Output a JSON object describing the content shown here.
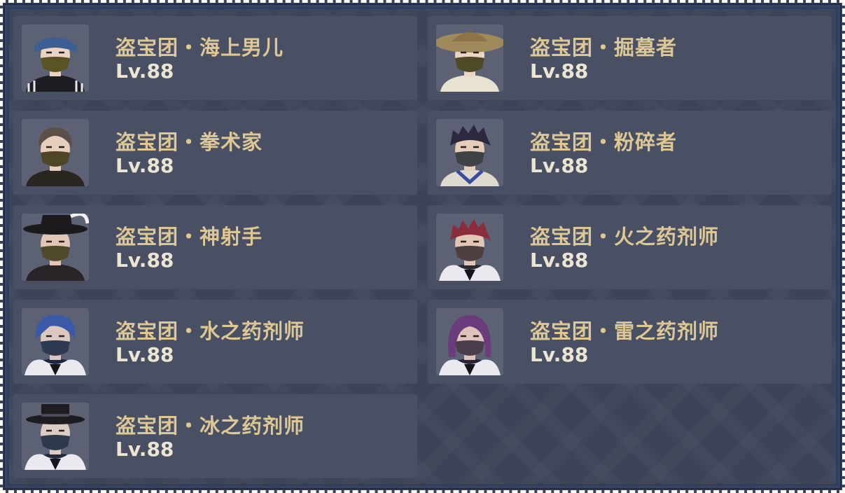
{
  "colors": {
    "name_text": "#dcc795",
    "level_text": "#ece5d3",
    "card_bg": "#4a5063",
    "panel_bg": "#3e4457",
    "border_dash": "#ffffff",
    "border_inner": "#2b3f63"
  },
  "enemies": [
    {
      "name": "盗宝团・海上男儿",
      "level": "Lv.88",
      "avatar_icon": "sailor-hooligan-portrait-icon",
      "hair": "#3a5a8c",
      "hat": "headband",
      "hat_color": "#3b5f92",
      "mask": "#5a5326",
      "skin": "#e9d3c2",
      "clothes": "#1d1d24",
      "collar": "stripe"
    },
    {
      "name": "盗宝团・掘墓者",
      "level": "Lv.88",
      "avatar_icon": "grave-robber-portrait-icon",
      "hair": "#4a3b2e",
      "hat": "straw",
      "hat_color": "#a08a5c",
      "mask": "#4d4a28",
      "skin": "#ead6c4",
      "clothes": "#e8e2d2",
      "collar": "plain"
    },
    {
      "name": "盗宝团・拳术家",
      "level": "Lv.88",
      "avatar_icon": "handyman-portrait-icon",
      "hair": "#5a5048",
      "hat": "none",
      "hat_color": "#000000",
      "mask": "#4f4628",
      "skin": "#e6cfbd",
      "clothes": "#2b2520",
      "collar": "plain"
    },
    {
      "name": "盗宝团・粉碎者",
      "level": "Lv.88",
      "avatar_icon": "crusher-portrait-icon",
      "hair": "#2b2840",
      "hat": "spiky",
      "hat_color": "#2b2840",
      "mask": "#3e4246",
      "skin": "#e5cdb9",
      "clothes": "#dedad0",
      "collar": "blue"
    },
    {
      "name": "盗宝团・神射手",
      "level": "Lv.88",
      "avatar_icon": "marksman-portrait-icon",
      "hair": "#8a6a70",
      "hat": "feather",
      "hat_color": "#1c1a1c",
      "mask": "#4f4a2c",
      "skin": "#e2c6b8",
      "clothes": "#2a2428",
      "collar": "plain"
    },
    {
      "name": "盗宝团・火之药剂师",
      "level": "Lv.88",
      "avatar_icon": "pyro-potioneer-portrait-icon",
      "hair": "#8a2e3e",
      "hat": "spiky",
      "hat_color": "#8a2e3e",
      "mask": "#4e4040",
      "skin": "#e2c6b6",
      "clothes": "#2a2a34",
      "collar": "fur"
    },
    {
      "name": "盗宝团・水之药剂师",
      "level": "Lv.88",
      "avatar_icon": "hydro-potioneer-portrait-icon",
      "hair": "#3a5aa8",
      "hat": "swept",
      "hat_color": "#3a5aa8",
      "mask": "#2e3a52",
      "skin": "#dcc8c0",
      "clothes": "#1f2640",
      "collar": "fur"
    },
    {
      "name": "盗宝团・雷之药剂师",
      "level": "Lv.88",
      "avatar_icon": "electro-potioneer-portrait-icon",
      "hair": "#6a3c7c",
      "hat": "long",
      "hat_color": "#6a3c7c",
      "mask": "#4a3e4c",
      "skin": "#dcc4bc",
      "clothes": "#2a2434",
      "collar": "fur"
    },
    {
      "name": "盗宝团・冰之药剂师",
      "level": "Lv.88",
      "avatar_icon": "cryo-potioneer-portrait-icon",
      "hair": "#8aa6c8",
      "hat": "tophat",
      "hat_color": "#1e1c20",
      "mask": "#2c3a4c",
      "skin": "#dcccc6",
      "clothes": "#1f2a3c",
      "collar": "fur"
    }
  ]
}
